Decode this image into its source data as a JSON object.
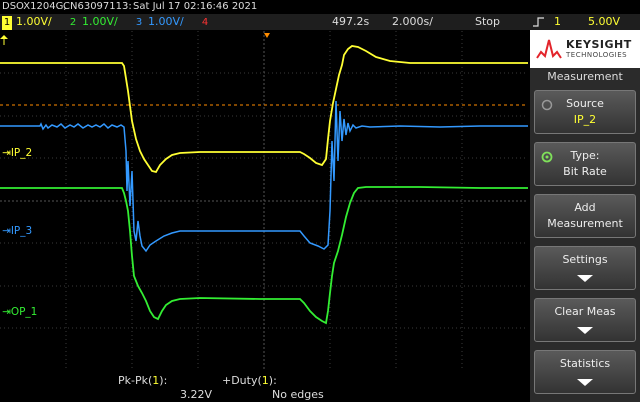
{
  "title": {
    "model": "DSOX1204G,",
    "serial": "CN63097113:",
    "datetime": "Sat Jul 17 02:16:46 2021"
  },
  "channels": [
    {
      "num": "1",
      "scale": "1.00V/",
      "color": "#ffff33"
    },
    {
      "num": "2",
      "scale": "1.00V/",
      "color": "#33ee33"
    },
    {
      "num": "3",
      "scale": "1.00V/",
      "color": "#3399ff"
    },
    {
      "num": "4",
      "scale": "",
      "color": "#ff3333"
    }
  ],
  "timebase": {
    "position": "497.2s",
    "scale": "2.000s/"
  },
  "run_state": "Stop",
  "trigger": {
    "channel": "1",
    "level": "5.00V"
  },
  "traces": {
    "ch1_label": "IP_2",
    "ch3_label": "IP_3",
    "ch2_label": "OP_1"
  },
  "sidebar": {
    "brand": "KEYSIGHT",
    "brand_sub": "TECHNOLOGIES",
    "menu_title": "Measurement",
    "softkeys": [
      {
        "line1": "Source",
        "line2": "IP_2",
        "value_color": "#ffff33"
      },
      {
        "line1": "Type:",
        "line2": "Bit Rate"
      },
      {
        "line1": "Add",
        "line2": "Measurement"
      },
      {
        "line1": "Settings",
        "line2": ""
      },
      {
        "line1": "Clear Meas",
        "line2": ""
      },
      {
        "line1": "Statistics",
        "line2": ""
      }
    ]
  },
  "measurements": [
    {
      "name": "Pk-Pk",
      "channel": "1",
      "value": "3.22V"
    },
    {
      "name": "+Duty",
      "channel": "1",
      "value": "No edges"
    }
  ],
  "colors": {
    "ch1": "#ffff33",
    "ch2": "#33ee33",
    "ch3": "#3399ff",
    "ch4": "#ff3333",
    "marker": "#ff8c00"
  }
}
